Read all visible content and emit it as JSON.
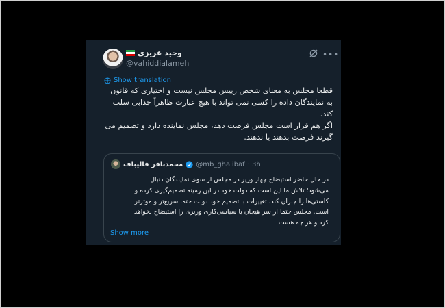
{
  "tweet": {
    "author_name": "وحید عزیزی",
    "author_handle": "@vahiddialameh",
    "show_translation": "Show translation",
    "body_lines": [
      "قطعا مجلس به معنای شخص رییس مجلس نیست و اختیاری که قانون",
      "به نمایندگان داده را کسی نمی تواند با هیچ عبارت ظاهراً جذابی سلب",
      "کند.",
      "اگر هم قرار است مجلس فرصت دهد، مجلس نماینده دارد و تصمیم می",
      "گیرند فرصت بدهند یا ندهند."
    ]
  },
  "quoted_tweet": {
    "author_name": "محمدباقر قالیباف",
    "author_handle": "@mb_ghalibaf",
    "time": "· 3h",
    "body_lines": [
      "در حال حاضر استیضاح چهار وزیر در مجلس از سوی نمایندگان دنبال",
      "می‌شود؛ تلاش ما این است که دولت خود در این زمینه تصمیم‌گیری کرده و",
      "کاستی‌ها را جبران کند. تغییرات با تصمیم خود دولت حتما سریع‌تر و موثرتر",
      "است. مجلس حتما از سر هیجان یا سیاسی‌کاری وزیری را استیضاح نخواهد",
      "کرد و هر چه هست"
    ],
    "show_more": "Show more"
  },
  "colors": {
    "background": "#000000",
    "card": "#15202b",
    "text": "#e7e9ea",
    "secondary": "#8b98a5",
    "accent": "#1d9bf0",
    "border": "#38444d"
  }
}
